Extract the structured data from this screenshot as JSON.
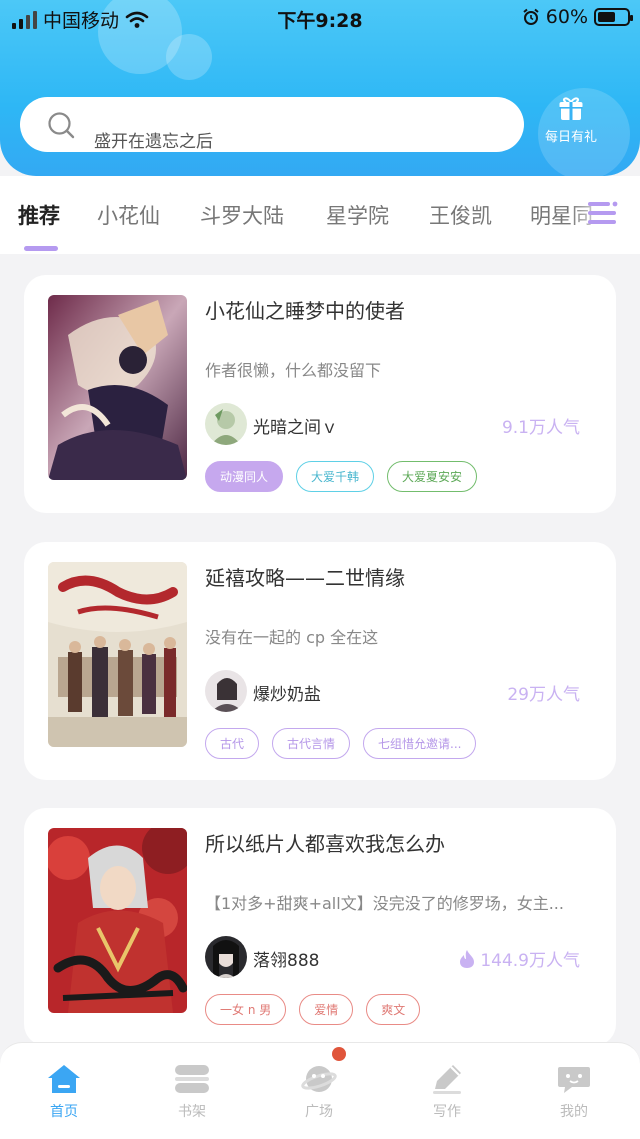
{
  "status_bar": {
    "carrier": "中国移动",
    "time": "下午9:28",
    "battery": "60%",
    "battery_level": 0.6
  },
  "search": {
    "placeholder": "盛开在遗忘之后"
  },
  "gift": {
    "label": "每日有礼",
    "icon": "gift-icon"
  },
  "tabs": [
    {
      "label": "推荐",
      "active": true
    },
    {
      "label": "小花仙"
    },
    {
      "label": "斗罗大陆"
    },
    {
      "label": "星学院"
    },
    {
      "label": "王俊凯"
    },
    {
      "label": "明星同"
    }
  ],
  "books": [
    {
      "title": "小花仙之睡梦中的使者",
      "desc": "作者很懒，什么都没留下",
      "author": "光暗之间ｖ",
      "popularity": "9.1万人气",
      "hot": false,
      "tags": [
        {
          "label": "动漫同人",
          "style": "filled",
          "color": "#c6a8ee"
        },
        {
          "label": "大爱千韩",
          "style": "outline",
          "color": "#5fd0e6"
        },
        {
          "label": "大爱夏安安",
          "style": "outline",
          "color": "#73bd6d"
        }
      ]
    },
    {
      "title": "延禧攻略——二世情缘",
      "desc": "没有在一起的 cp 全在这",
      "author": "爆炒奶盐",
      "popularity": "29万人气",
      "hot": false,
      "tags": [
        {
          "label": "古代",
          "style": "outline",
          "color": "#c3a8ee"
        },
        {
          "label": "古代言情",
          "style": "outline",
          "color": "#c3a8ee"
        },
        {
          "label": "七组惜允邀请...",
          "style": "outline",
          "color": "#c3a8ee"
        }
      ]
    },
    {
      "title": "所以纸片人都喜欢我怎么办",
      "desc": "【1对多+甜爽+all文】没完没了的修罗场，女主...",
      "author": "落翎888",
      "popularity": "144.9万人气",
      "hot": true,
      "tags": [
        {
          "label": "一女 n 男",
          "style": "outline",
          "color": "#e98b86"
        },
        {
          "label": "爱情",
          "style": "outline",
          "color": "#e98b86"
        },
        {
          "label": "爽文",
          "style": "outline",
          "color": "#e98b86"
        }
      ]
    }
  ],
  "bottom_nav": [
    {
      "label": "首页",
      "icon": "home-icon",
      "active": true
    },
    {
      "label": "书架",
      "icon": "bookshelf-icon"
    },
    {
      "label": "广场",
      "icon": "planet-icon",
      "badge": true
    },
    {
      "label": "写作",
      "icon": "pen-icon"
    },
    {
      "label": "我的",
      "icon": "chat-icon"
    }
  ],
  "colors": {
    "header": "#2eb7f5",
    "accent": "#b59af0",
    "nav_active": "#3ba6f3",
    "badge": "#e0553b"
  }
}
